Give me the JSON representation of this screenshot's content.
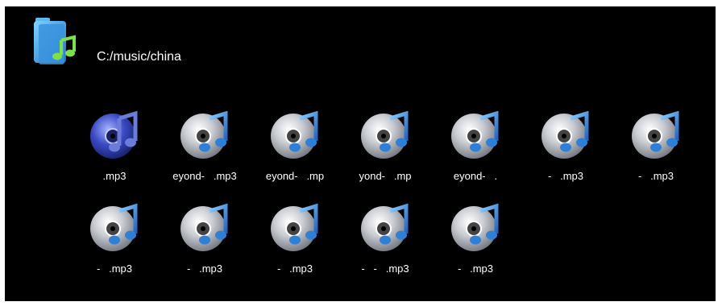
{
  "header": {
    "path": "C:/music/china",
    "folder_icon": "music-folder-icon"
  },
  "files": {
    "row1": [
      {
        "label": ".mp3",
        "selected": true
      },
      {
        "label": "eyond-   .mp3"
      },
      {
        "label": "eyond-   .mp"
      },
      {
        "label": "yond-   .mp"
      },
      {
        "label": "eyond-   ."
      },
      {
        "label": "-   .mp3"
      },
      {
        "label": "-   .mp3"
      }
    ],
    "row2": [
      {
        "label": "-   .mp3"
      },
      {
        "label": "-   .mp3"
      },
      {
        "label": "-   .mp3"
      },
      {
        "label": "-   -   .mp3"
      },
      {
        "label": "-   .mp3"
      }
    ]
  },
  "colors": {
    "background": "#000000",
    "text": "#ffffff",
    "note_blue": "#2f7fd6",
    "selected_disc": "#2d3fa8"
  }
}
